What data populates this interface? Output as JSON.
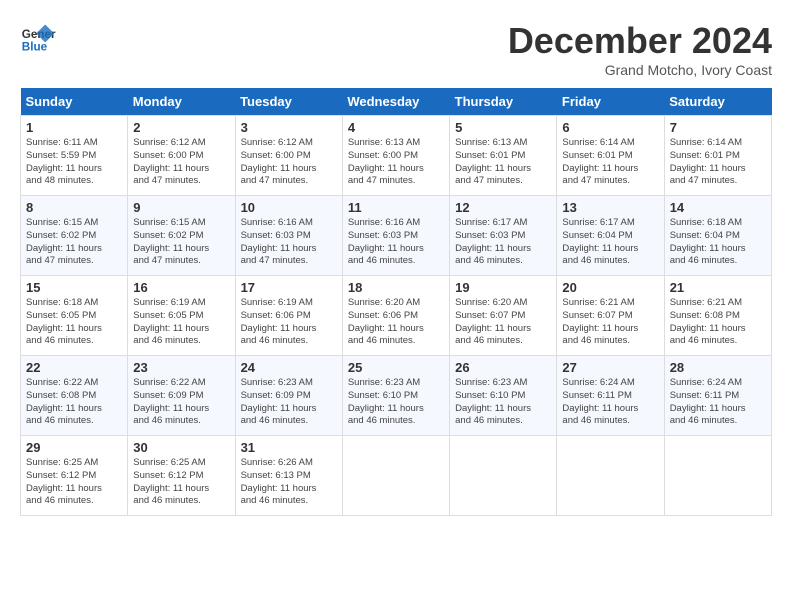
{
  "header": {
    "logo_line1": "General",
    "logo_line2": "Blue",
    "month": "December 2024",
    "location": "Grand Motcho, Ivory Coast"
  },
  "weekdays": [
    "Sunday",
    "Monday",
    "Tuesday",
    "Wednesday",
    "Thursday",
    "Friday",
    "Saturday"
  ],
  "weeks": [
    [
      {
        "day": "1",
        "info": "Sunrise: 6:11 AM\nSunset: 5:59 PM\nDaylight: 11 hours\nand 48 minutes."
      },
      {
        "day": "2",
        "info": "Sunrise: 6:12 AM\nSunset: 6:00 PM\nDaylight: 11 hours\nand 47 minutes."
      },
      {
        "day": "3",
        "info": "Sunrise: 6:12 AM\nSunset: 6:00 PM\nDaylight: 11 hours\nand 47 minutes."
      },
      {
        "day": "4",
        "info": "Sunrise: 6:13 AM\nSunset: 6:00 PM\nDaylight: 11 hours\nand 47 minutes."
      },
      {
        "day": "5",
        "info": "Sunrise: 6:13 AM\nSunset: 6:01 PM\nDaylight: 11 hours\nand 47 minutes."
      },
      {
        "day": "6",
        "info": "Sunrise: 6:14 AM\nSunset: 6:01 PM\nDaylight: 11 hours\nand 47 minutes."
      },
      {
        "day": "7",
        "info": "Sunrise: 6:14 AM\nSunset: 6:01 PM\nDaylight: 11 hours\nand 47 minutes."
      }
    ],
    [
      {
        "day": "8",
        "info": "Sunrise: 6:15 AM\nSunset: 6:02 PM\nDaylight: 11 hours\nand 47 minutes."
      },
      {
        "day": "9",
        "info": "Sunrise: 6:15 AM\nSunset: 6:02 PM\nDaylight: 11 hours\nand 47 minutes."
      },
      {
        "day": "10",
        "info": "Sunrise: 6:16 AM\nSunset: 6:03 PM\nDaylight: 11 hours\nand 47 minutes."
      },
      {
        "day": "11",
        "info": "Sunrise: 6:16 AM\nSunset: 6:03 PM\nDaylight: 11 hours\nand 46 minutes."
      },
      {
        "day": "12",
        "info": "Sunrise: 6:17 AM\nSunset: 6:03 PM\nDaylight: 11 hours\nand 46 minutes."
      },
      {
        "day": "13",
        "info": "Sunrise: 6:17 AM\nSunset: 6:04 PM\nDaylight: 11 hours\nand 46 minutes."
      },
      {
        "day": "14",
        "info": "Sunrise: 6:18 AM\nSunset: 6:04 PM\nDaylight: 11 hours\nand 46 minutes."
      }
    ],
    [
      {
        "day": "15",
        "info": "Sunrise: 6:18 AM\nSunset: 6:05 PM\nDaylight: 11 hours\nand 46 minutes."
      },
      {
        "day": "16",
        "info": "Sunrise: 6:19 AM\nSunset: 6:05 PM\nDaylight: 11 hours\nand 46 minutes."
      },
      {
        "day": "17",
        "info": "Sunrise: 6:19 AM\nSunset: 6:06 PM\nDaylight: 11 hours\nand 46 minutes."
      },
      {
        "day": "18",
        "info": "Sunrise: 6:20 AM\nSunset: 6:06 PM\nDaylight: 11 hours\nand 46 minutes."
      },
      {
        "day": "19",
        "info": "Sunrise: 6:20 AM\nSunset: 6:07 PM\nDaylight: 11 hours\nand 46 minutes."
      },
      {
        "day": "20",
        "info": "Sunrise: 6:21 AM\nSunset: 6:07 PM\nDaylight: 11 hours\nand 46 minutes."
      },
      {
        "day": "21",
        "info": "Sunrise: 6:21 AM\nSunset: 6:08 PM\nDaylight: 11 hours\nand 46 minutes."
      }
    ],
    [
      {
        "day": "22",
        "info": "Sunrise: 6:22 AM\nSunset: 6:08 PM\nDaylight: 11 hours\nand 46 minutes."
      },
      {
        "day": "23",
        "info": "Sunrise: 6:22 AM\nSunset: 6:09 PM\nDaylight: 11 hours\nand 46 minutes."
      },
      {
        "day": "24",
        "info": "Sunrise: 6:23 AM\nSunset: 6:09 PM\nDaylight: 11 hours\nand 46 minutes."
      },
      {
        "day": "25",
        "info": "Sunrise: 6:23 AM\nSunset: 6:10 PM\nDaylight: 11 hours\nand 46 minutes."
      },
      {
        "day": "26",
        "info": "Sunrise: 6:23 AM\nSunset: 6:10 PM\nDaylight: 11 hours\nand 46 minutes."
      },
      {
        "day": "27",
        "info": "Sunrise: 6:24 AM\nSunset: 6:11 PM\nDaylight: 11 hours\nand 46 minutes."
      },
      {
        "day": "28",
        "info": "Sunrise: 6:24 AM\nSunset: 6:11 PM\nDaylight: 11 hours\nand 46 minutes."
      }
    ],
    [
      {
        "day": "29",
        "info": "Sunrise: 6:25 AM\nSunset: 6:12 PM\nDaylight: 11 hours\nand 46 minutes."
      },
      {
        "day": "30",
        "info": "Sunrise: 6:25 AM\nSunset: 6:12 PM\nDaylight: 11 hours\nand 46 minutes."
      },
      {
        "day": "31",
        "info": "Sunrise: 6:26 AM\nSunset: 6:13 PM\nDaylight: 11 hours\nand 46 minutes."
      },
      {
        "day": "",
        "info": ""
      },
      {
        "day": "",
        "info": ""
      },
      {
        "day": "",
        "info": ""
      },
      {
        "day": "",
        "info": ""
      }
    ]
  ]
}
